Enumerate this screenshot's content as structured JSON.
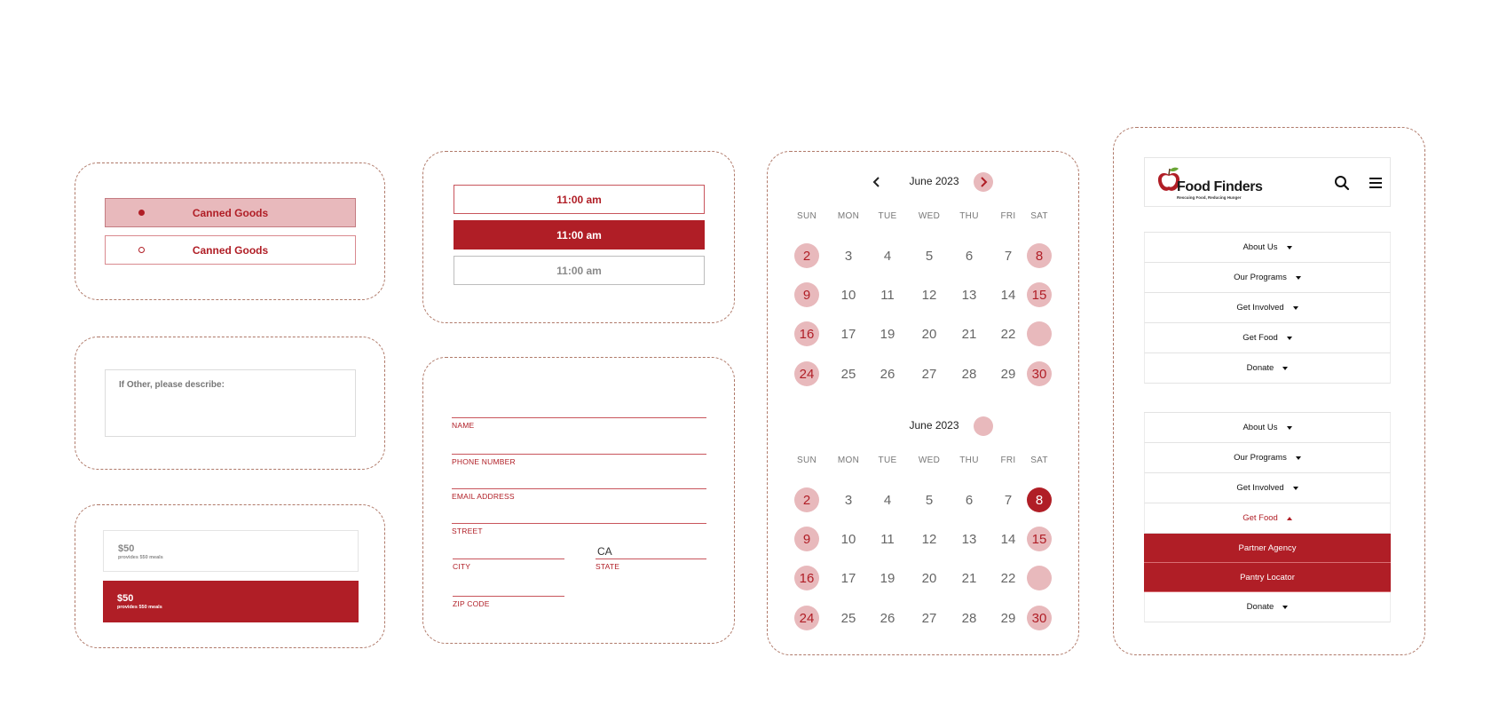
{
  "colors": {
    "primary": "#b01e26",
    "primary_light": "#e8b9bc",
    "dashed_border": "#b07a6a"
  },
  "radio": {
    "options": [
      {
        "label": "Canned Goods",
        "selected": true
      },
      {
        "label": "Canned Goods",
        "selected": false
      }
    ]
  },
  "describe": {
    "placeholder": "If Other, please describe:"
  },
  "donation": {
    "options": [
      {
        "amount": "$50",
        "note": "provides 550 meals",
        "selected": false
      },
      {
        "amount": "$50",
        "note": "provides 550 meals",
        "selected": true
      }
    ]
  },
  "time_slots": [
    {
      "label": "11:00 am",
      "state": "outline"
    },
    {
      "label": "11:00 am",
      "state": "selected"
    },
    {
      "label": "11:00 am",
      "state": "disabled"
    }
  ],
  "address_form": {
    "name_label": "NAME",
    "phone_label": "PHONE NUMBER",
    "email_label": "EMAIL ADDRESS",
    "street_label": "STREET",
    "city_label": "CITY",
    "state_label": "STATE",
    "state_value": "CA",
    "zip_label": "ZIP CODE"
  },
  "calendars": [
    {
      "title": "June 2023",
      "weekdays": [
        "SUN",
        "MON",
        "TUE",
        "WED",
        "THU",
        "FRI",
        "SAT"
      ],
      "weeks": [
        [
          "2",
          "3",
          "4",
          "5",
          "6",
          "7",
          "8"
        ],
        [
          "9",
          "10",
          "11",
          "12",
          "13",
          "14",
          "15"
        ],
        [
          "16",
          "17",
          "19",
          "20",
          "21",
          "22",
          ""
        ],
        [
          "24",
          "25",
          "26",
          "27",
          "28",
          "29",
          "30"
        ]
      ],
      "highlighted": [
        "2",
        "8",
        "9",
        "15",
        "16",
        "24",
        "30"
      ],
      "selected": "",
      "empty_highlight_saturday_week3": true
    },
    {
      "title": "June 2023",
      "weekdays": [
        "SUN",
        "MON",
        "TUE",
        "WED",
        "THU",
        "FRI",
        "SAT"
      ],
      "weeks": [
        [
          "2",
          "3",
          "4",
          "5",
          "6",
          "7",
          "8"
        ],
        [
          "9",
          "10",
          "11",
          "12",
          "13",
          "14",
          "15"
        ],
        [
          "16",
          "17",
          "19",
          "20",
          "21",
          "22",
          ""
        ],
        [
          "24",
          "25",
          "26",
          "27",
          "28",
          "29",
          "30"
        ]
      ],
      "highlighted": [
        "2",
        "9",
        "15",
        "16",
        "24",
        "30"
      ],
      "selected": "8",
      "empty_highlight_saturday_week3": true
    }
  ],
  "site": {
    "logo_name": "Food Finders",
    "logo_tagline": "Rescuing Food, Reducing Hunger",
    "search_icon": "search-icon",
    "menu_icon": "hamburger-icon"
  },
  "menu_collapsed": [
    "About Us",
    "Our Programs",
    "Get Involved",
    "Get Food",
    "Donate"
  ],
  "menu_expanded": {
    "before": [
      "About Us",
      "Our Programs",
      "Get Involved"
    ],
    "open_item": "Get Food",
    "sub_items": [
      "Partner Agency",
      "Pantry Locator"
    ],
    "after": [
      "Donate"
    ]
  }
}
